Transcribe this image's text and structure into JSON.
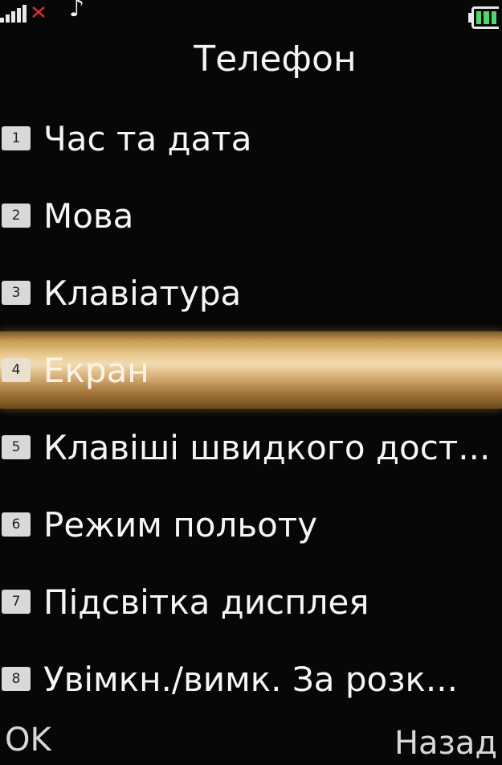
{
  "status": {
    "signal_icon": "signal-bars-icon",
    "network_icon": "network-off-icon",
    "music_icon": "music-note-icon",
    "battery_icon": "battery-icon",
    "battery_color": "#4fd86a"
  },
  "title": "Телефон",
  "menu": {
    "items": [
      {
        "num": "1",
        "label": "Час та дата"
      },
      {
        "num": "2",
        "label": "Мова"
      },
      {
        "num": "3",
        "label": "Клавіатура"
      },
      {
        "num": "4",
        "label": "Екран",
        "selected": true
      },
      {
        "num": "5",
        "label": "Клавіші швидкого дост..."
      },
      {
        "num": "6",
        "label": "Режим польоту"
      },
      {
        "num": "7",
        "label": "Підсвітка дисплея"
      },
      {
        "num": "8",
        "label": "Увімкн./вимк. За розк..."
      }
    ]
  },
  "softkeys": {
    "left": "OK",
    "right": "Назад"
  }
}
